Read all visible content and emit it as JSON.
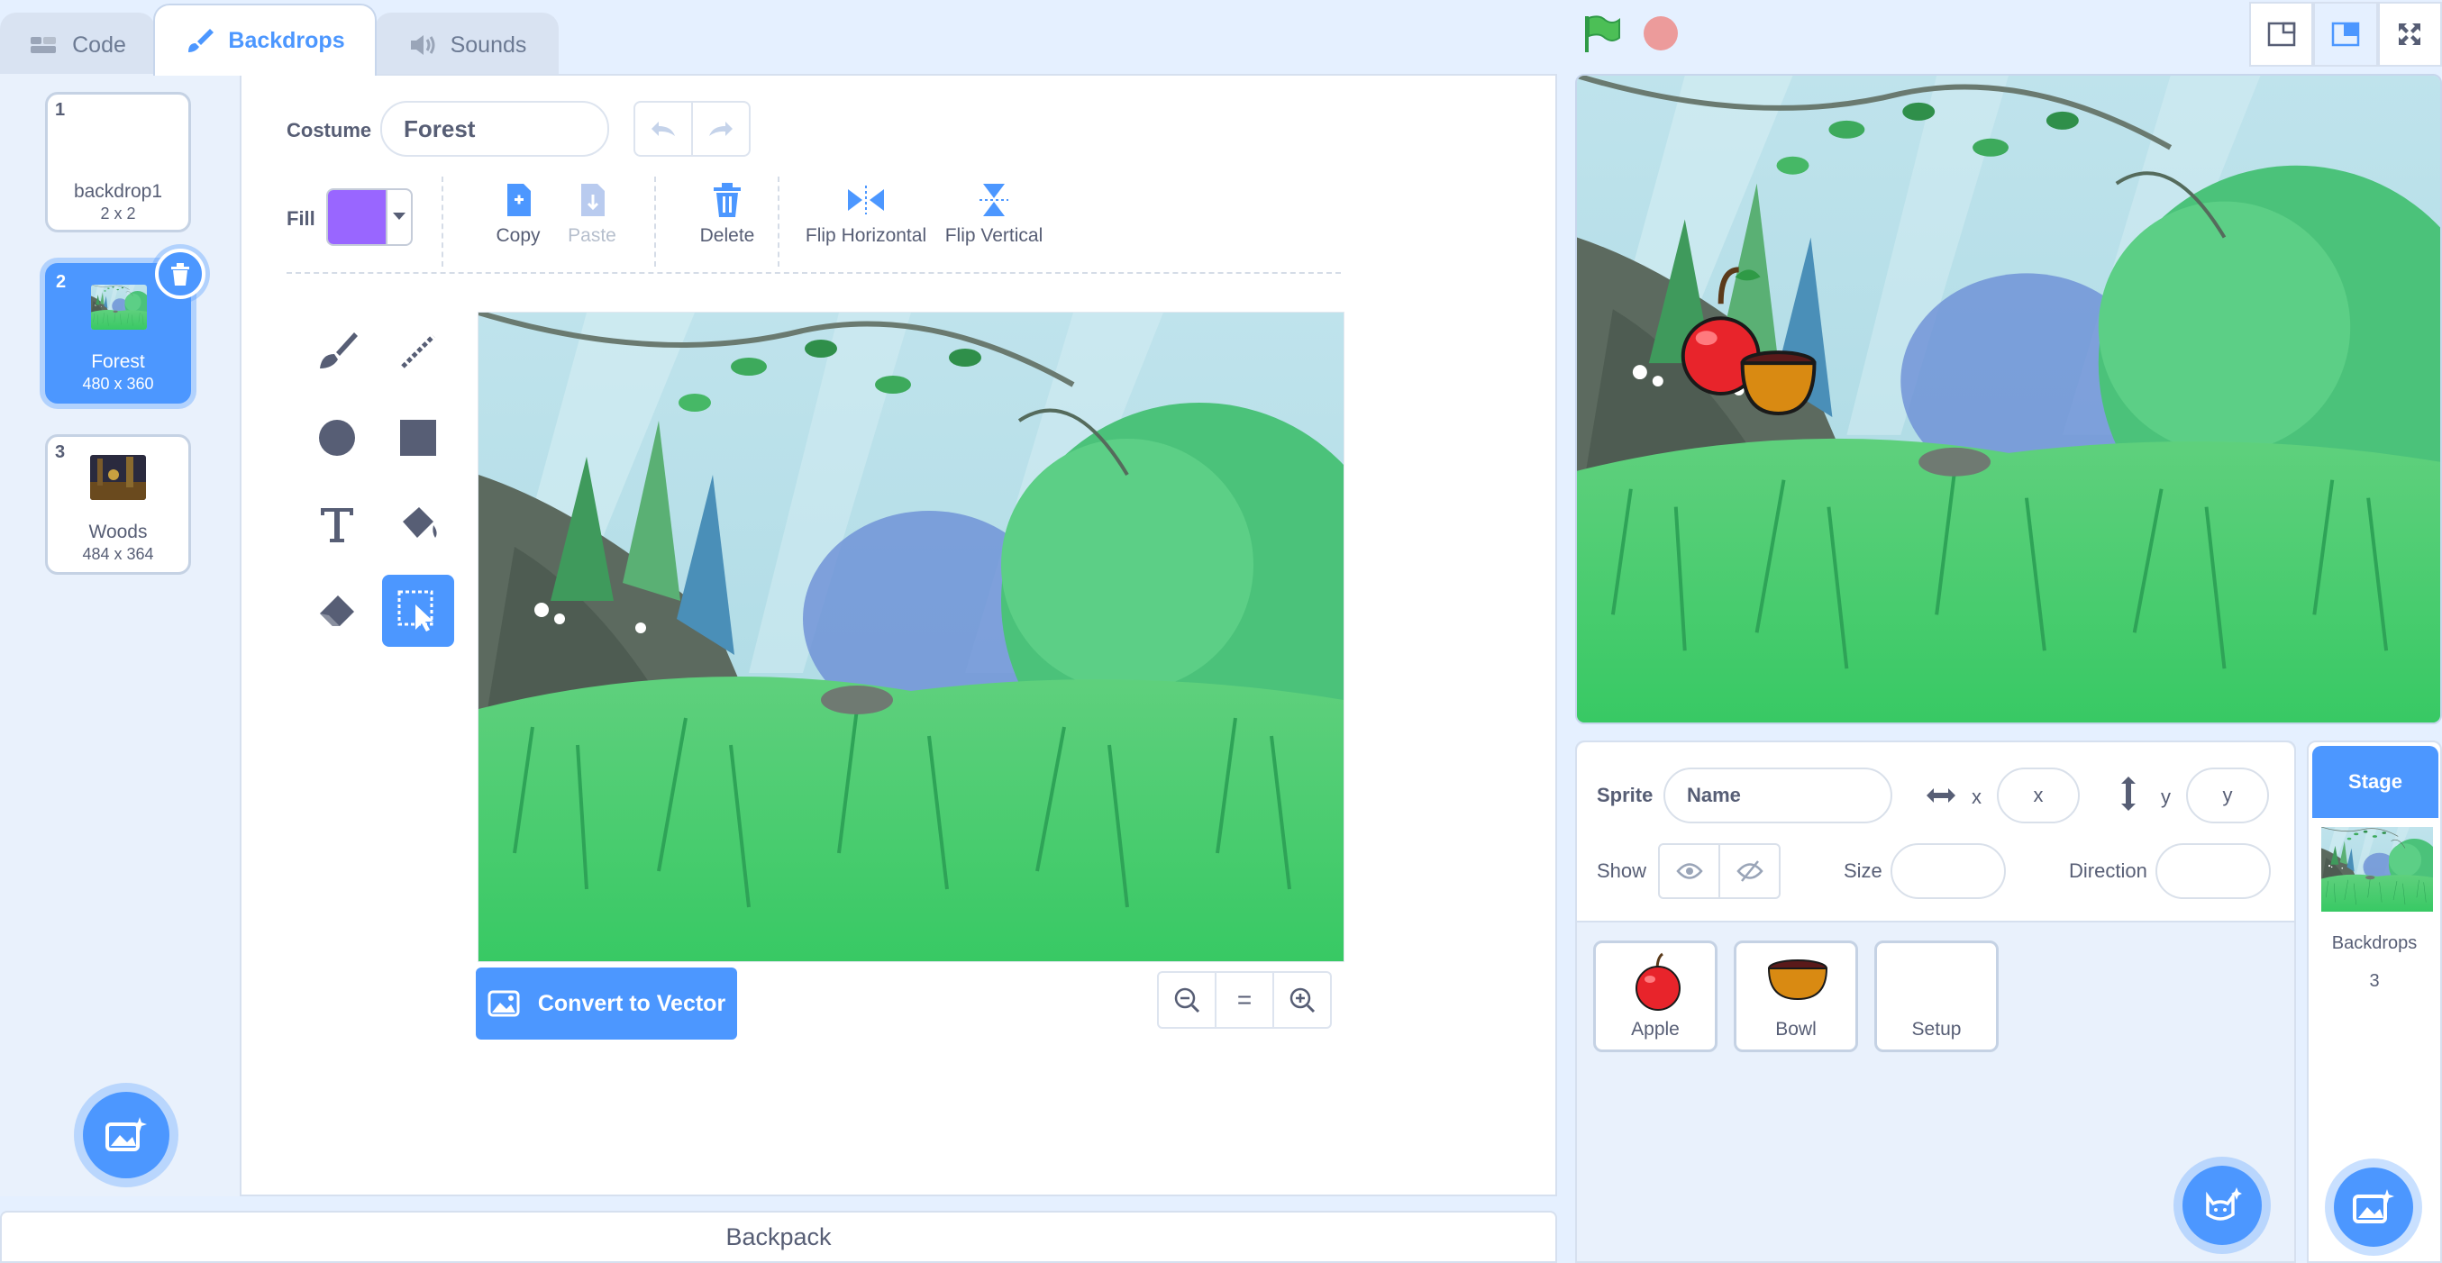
{
  "tabs": [
    {
      "label": "Code",
      "icon": "code-icon"
    },
    {
      "label": "Backdrops",
      "icon": "brush-icon"
    },
    {
      "label": "Sounds",
      "icon": "speaker-icon"
    }
  ],
  "backdrops": [
    {
      "number": "1",
      "name": "backdrop1",
      "size": "2 x 2"
    },
    {
      "number": "2",
      "name": "Forest",
      "size": "480 x 360"
    },
    {
      "number": "3",
      "name": "Woods",
      "size": "484 x 364"
    }
  ],
  "editor": {
    "costume_label": "Costume",
    "costume_name": "Forest",
    "fill_label": "Fill",
    "fill_color": "#9966ff",
    "copy_label": "Copy",
    "paste_label": "Paste",
    "delete_label": "Delete",
    "flip_h_label": "Flip Horizontal",
    "flip_v_label": "Flip Vertical",
    "convert_label": "Convert to Vector",
    "zoom_reset": "="
  },
  "backpack_label": "Backpack",
  "sprite_info": {
    "sprite_label": "Sprite",
    "name_placeholder": "Name",
    "x_label": "x",
    "x_placeholder": "x",
    "y_label": "y",
    "y_placeholder": "y",
    "show_label": "Show",
    "size_label": "Size",
    "direction_label": "Direction"
  },
  "sprites": [
    {
      "name": "Apple"
    },
    {
      "name": "Bowl"
    },
    {
      "name": "Setup"
    }
  ],
  "stage_pane": {
    "title": "Stage",
    "backdrops_label": "Backdrops",
    "backdrops_count": "3"
  },
  "colors": {
    "accent": "#4c97ff",
    "background": "#e5f0ff",
    "text": "#575e75"
  }
}
